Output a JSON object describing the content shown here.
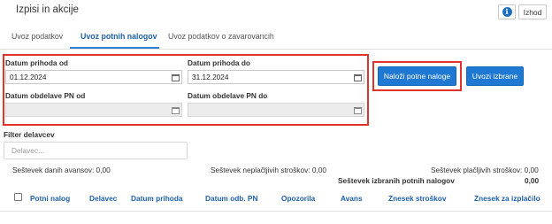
{
  "header": {
    "title": "Izpisi in akcije",
    "info_icon_glyph": "i",
    "exit_label": "Izhod"
  },
  "tabs": [
    {
      "label": "Uvoz podatkov",
      "active": false
    },
    {
      "label": "Uvoz potnih nalogov",
      "active": true
    },
    {
      "label": "Uvoz podatkov o zavarovancih",
      "active": false
    }
  ],
  "filters": {
    "date_from_label": "Datum prihoda od",
    "date_from_value": "01.12.2024",
    "date_to_label": "Datum prihoda do",
    "date_to_value": "31.12.2024",
    "pn_from_label": "Datum obdelave PN od",
    "pn_from_value": "",
    "pn_to_label": "Datum obdelave PN do",
    "pn_to_value": "",
    "worker_filter_label": "Filter delavcev",
    "worker_filter_placeholder": "Delavec..."
  },
  "buttons": {
    "load_orders": "Naloži potne naloge",
    "import_selected": "Uvozi izbrane"
  },
  "sums": {
    "advances": "Seštevek danih avansov: 0,00",
    "unpaid_costs": "Seštevek neplačljivih stroškov: 0,00",
    "paid_costs": "Seštevek plačljivih stroškov: 0,00",
    "selected_label": "Seštevek izbranih potnih nalogov",
    "selected_value": "0,00"
  },
  "table": {
    "columns": [
      "Potni nalog",
      "Delavec",
      "Datum prihoda",
      "Datum odb. PN",
      "Opozorila",
      "Avans",
      "Znesek stroškov",
      "Znesek za izplačilo"
    ]
  },
  "colors": {
    "accent": "#1f78d1",
    "highlight": "#e0342b",
    "link": "#1f5fa8"
  }
}
